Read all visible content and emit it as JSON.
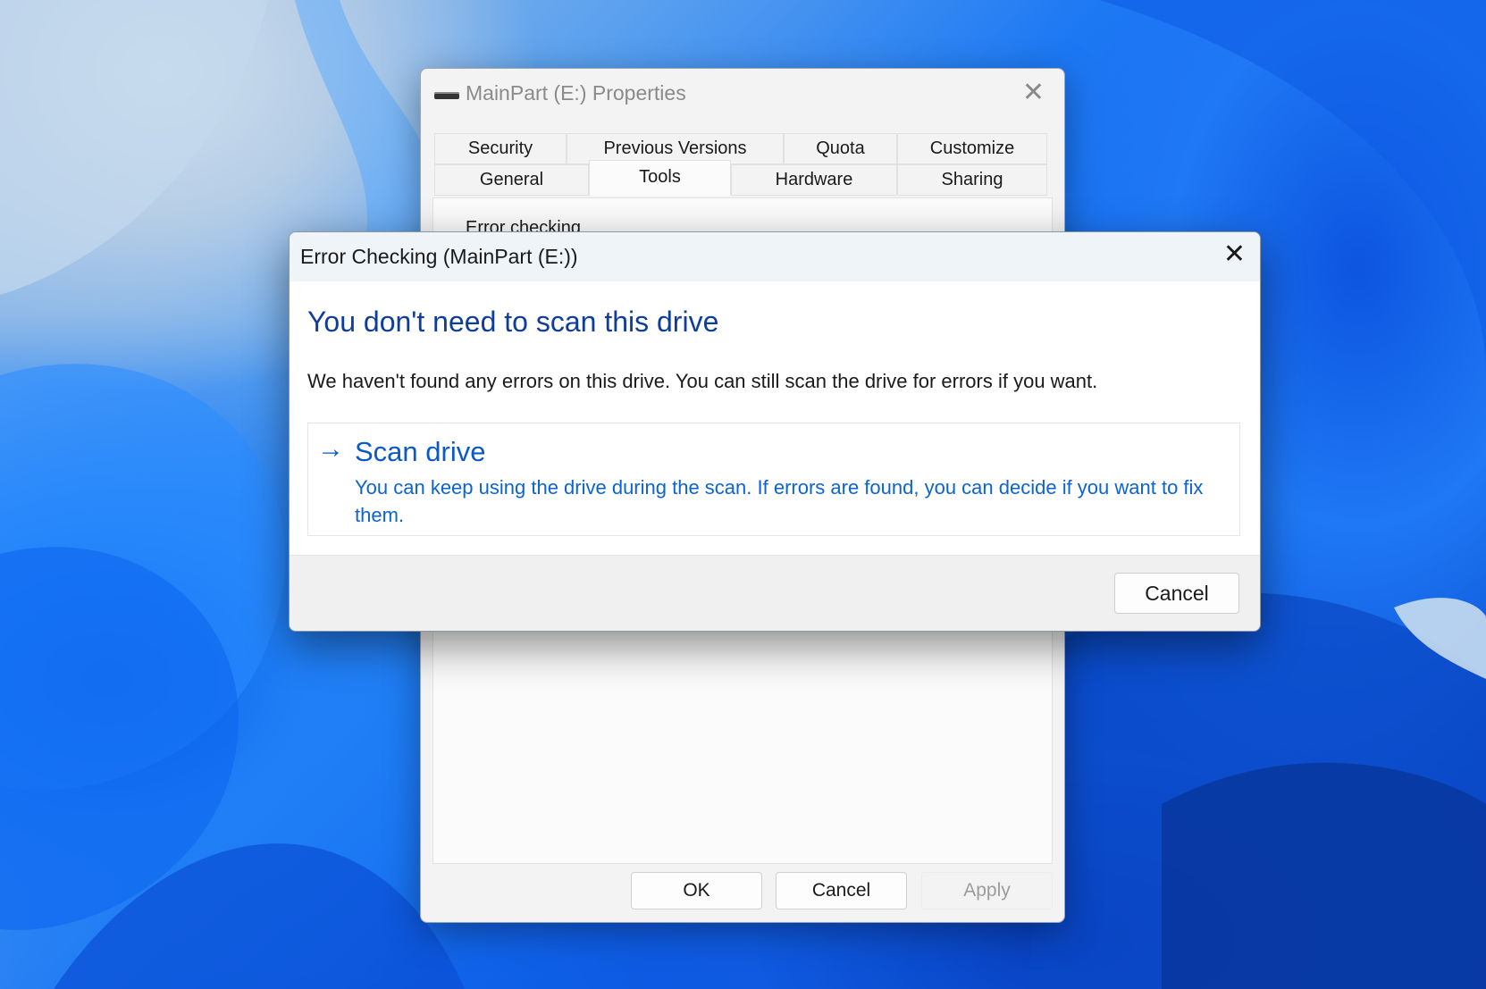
{
  "properties_window": {
    "title": "MainPart (E:) Properties",
    "tabs_row1": [
      "Security",
      "Previous Versions",
      "Quota",
      "Customize"
    ],
    "tabs_row2": [
      "General",
      "Tools",
      "Hardware",
      "Sharing"
    ],
    "active_tab": "Tools",
    "section_label": "Error checking",
    "buttons": {
      "ok": "OK",
      "cancel": "Cancel",
      "apply": "Apply"
    }
  },
  "error_dialog": {
    "title": "Error Checking (MainPart (E:))",
    "heading": "You don't need to scan this drive",
    "description": "We haven't found any errors on this drive. You can still scan the drive for errors if you want.",
    "command_link": {
      "label": "Scan drive",
      "description": "You can keep using the drive during the scan. If errors are found, you can decide if you want to fix them."
    },
    "cancel": "Cancel"
  },
  "icons": {
    "close": "close-icon",
    "drive": "drive-icon",
    "arrow": "arrow-right-icon"
  },
  "colors": {
    "heading": "#0f3d9c",
    "link": "#0b58c9",
    "wallpaper": "#1c78f3"
  }
}
